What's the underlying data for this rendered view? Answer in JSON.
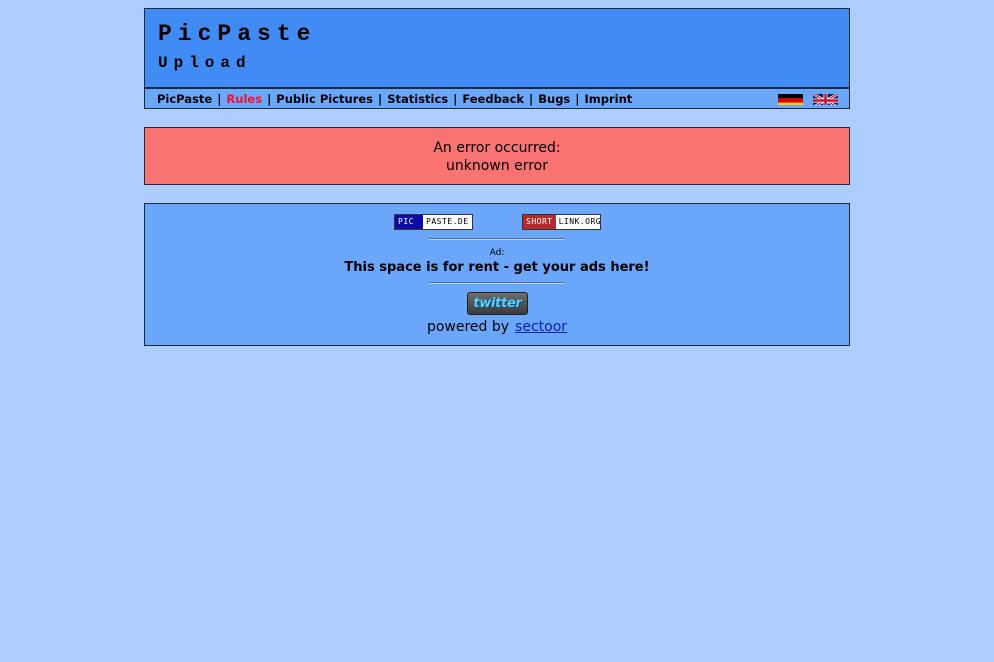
{
  "header": {
    "title": "PicPaste",
    "subtitle": "Upload"
  },
  "nav": {
    "items": [
      {
        "label": "PicPaste",
        "active": false
      },
      {
        "label": "Rules",
        "active": true
      },
      {
        "label": "Public Pictures",
        "active": false
      },
      {
        "label": "Statistics",
        "active": false
      },
      {
        "label": "Feedback",
        "active": false
      },
      {
        "label": "Bugs",
        "active": false
      },
      {
        "label": "Imprint",
        "active": false
      }
    ],
    "separator": "|",
    "active_color": "#f0102a",
    "languages": [
      {
        "icon": "german-flag-icon"
      },
      {
        "icon": "uk-flag-icon"
      }
    ]
  },
  "error": {
    "line1": "An error occurred:",
    "line2": "unknown error"
  },
  "footer": {
    "badges": [
      {
        "part1": "PIC",
        "part2": "PASTE.DE"
      },
      {
        "part1": "SHORT",
        "part2": "LINK.ORG"
      }
    ],
    "ad_label": "Ad:",
    "ad_text": "This space is for rent - get your ads here!",
    "twitter_label": "twitter",
    "powered_by": "powered by",
    "powered_link": "sectoor"
  },
  "colors": {
    "background": "#adcdfd",
    "header_bg": "#418bf4",
    "nav_bg": "#6aa6fa",
    "error_bg": "#f87372",
    "link": "#0a1fb0"
  }
}
